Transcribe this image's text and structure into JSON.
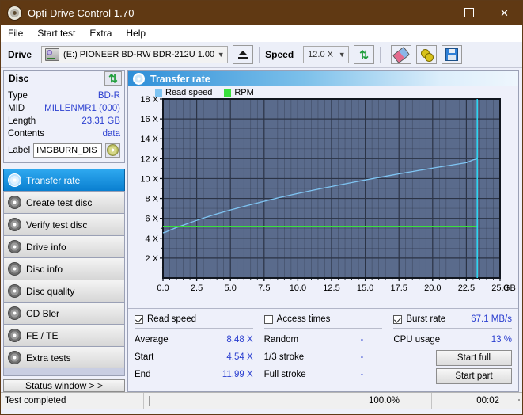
{
  "window": {
    "title": "Opti Drive Control 1.70",
    "icon": "disc-icon",
    "controls": {
      "minimize": "minimize-icon",
      "maximize": "maximize-icon",
      "close": "close-icon"
    }
  },
  "menu": {
    "items": [
      "File",
      "Start test",
      "Extra",
      "Help"
    ]
  },
  "toolbar": {
    "drive_label": "Drive",
    "drive_value": "(E:)  PIONEER BD-RW   BDR-212U 1.00",
    "eject_icon": "eject-icon",
    "speed_label": "Speed",
    "speed_value": "12.0 X",
    "refresh_icon": "refresh-icon",
    "erase_icon": "eraser-icon",
    "tools_icon": "bulb-icon",
    "save_icon": "floppy-save-icon"
  },
  "disc": {
    "header": "Disc",
    "refresh_icon": "refresh-icon",
    "rows": [
      {
        "key": "Type",
        "value": "BD-R"
      },
      {
        "key": "MID",
        "value": "MILLENMR1 (000)"
      },
      {
        "key": "Length",
        "value": "23.31 GB"
      },
      {
        "key": "Contents",
        "value": "data"
      }
    ],
    "label_key": "Label",
    "label_value": "IMGBURN_DIS",
    "disc_icon": "cd-icon"
  },
  "sidebar": {
    "items": [
      {
        "label": "Transfer rate",
        "icon": "disc-icon",
        "active": true
      },
      {
        "label": "Create test disc",
        "icon": "disc-icon",
        "active": false
      },
      {
        "label": "Verify test disc",
        "icon": "disc-icon",
        "active": false
      },
      {
        "label": "Drive info",
        "icon": "disc-icon",
        "active": false
      },
      {
        "label": "Disc info",
        "icon": "disc-icon",
        "active": false
      },
      {
        "label": "Disc quality",
        "icon": "disc-icon",
        "active": false
      },
      {
        "label": "CD Bler",
        "icon": "disc-icon",
        "active": false
      },
      {
        "label": "FE / TE",
        "icon": "disc-icon",
        "active": false
      },
      {
        "label": "Extra tests",
        "icon": "disc-icon",
        "active": false
      }
    ],
    "status_window_button": "Status window > >"
  },
  "panel": {
    "title": "Transfer rate",
    "icon": "disc-icon"
  },
  "chart_data": {
    "type": "line",
    "title": "Transfer rate",
    "xlabel": "GB",
    "ylabel": "X",
    "xlim": [
      0.0,
      25.0
    ],
    "ylim": [
      0,
      18
    ],
    "xticks": [
      "0.0",
      "2.5",
      "5.0",
      "7.5",
      "10.0",
      "12.5",
      "15.0",
      "17.5",
      "20.0",
      "22.5",
      "25.0"
    ],
    "xtick_values": [
      0.0,
      2.5,
      5.0,
      7.5,
      10.0,
      12.5,
      15.0,
      17.5,
      20.0,
      22.5,
      25.0
    ],
    "yticks": [
      "2 X",
      "4 X",
      "6 X",
      "8 X",
      "10 X",
      "12 X",
      "14 X",
      "16 X",
      "18 X"
    ],
    "ytick_values": [
      2,
      4,
      6,
      8,
      10,
      12,
      14,
      16,
      18
    ],
    "x_unit": "GB",
    "grid": true,
    "legend_position": "top-left",
    "plot_bg": "#5a6b8c",
    "grid_color": "#2b3345",
    "marker_x": 23.31,
    "marker_color": "#2fd4f0",
    "series": [
      {
        "name": "Read speed",
        "color": "#7fc4f2",
        "points": [
          [
            0.0,
            4.54
          ],
          [
            0.2,
            4.62
          ],
          [
            0.5,
            4.8
          ],
          [
            1.0,
            5.08
          ],
          [
            1.5,
            5.32
          ],
          [
            2.0,
            5.56
          ],
          [
            2.5,
            5.8
          ],
          [
            3.0,
            6.02
          ],
          [
            3.5,
            6.24
          ],
          [
            4.0,
            6.45
          ],
          [
            4.5,
            6.64
          ],
          [
            5.0,
            6.84
          ],
          [
            5.5,
            7.02
          ],
          [
            6.0,
            7.2
          ],
          [
            6.5,
            7.38
          ],
          [
            7.0,
            7.55
          ],
          [
            7.5,
            7.72
          ],
          [
            8.0,
            7.88
          ],
          [
            8.5,
            8.04
          ],
          [
            9.0,
            8.2
          ],
          [
            9.5,
            8.35
          ],
          [
            10.0,
            8.5
          ],
          [
            10.5,
            8.64
          ],
          [
            11.0,
            8.79
          ],
          [
            11.5,
            8.93
          ],
          [
            12.0,
            9.07
          ],
          [
            12.5,
            9.2
          ],
          [
            13.0,
            9.34
          ],
          [
            13.5,
            9.47
          ],
          [
            14.0,
            9.6
          ],
          [
            14.5,
            9.73
          ],
          [
            15.0,
            9.86
          ],
          [
            15.5,
            9.98
          ],
          [
            16.0,
            10.1
          ],
          [
            16.5,
            10.23
          ],
          [
            17.0,
            10.35
          ],
          [
            17.5,
            10.47
          ],
          [
            18.0,
            10.59
          ],
          [
            18.5,
            10.7
          ],
          [
            19.0,
            10.82
          ],
          [
            19.5,
            10.93
          ],
          [
            20.0,
            11.05
          ],
          [
            20.5,
            11.16
          ],
          [
            21.0,
            11.27
          ],
          [
            21.5,
            11.38
          ],
          [
            22.0,
            11.49
          ],
          [
            22.5,
            11.6
          ],
          [
            23.0,
            11.88
          ],
          [
            23.31,
            11.99
          ]
        ]
      },
      {
        "name": "RPM",
        "color": "#39e03c",
        "points": [
          [
            0.0,
            5.2
          ],
          [
            2.0,
            5.2
          ],
          [
            4.0,
            5.2
          ],
          [
            6.0,
            5.2
          ],
          [
            8.0,
            5.2
          ],
          [
            10.0,
            5.2
          ],
          [
            12.0,
            5.2
          ],
          [
            14.0,
            5.2
          ],
          [
            16.0,
            5.2
          ],
          [
            18.0,
            5.2
          ],
          [
            20.0,
            5.2
          ],
          [
            22.0,
            5.2
          ],
          [
            23.31,
            5.2
          ]
        ]
      }
    ],
    "legend": [
      {
        "label": "Read speed",
        "color": "#7fc4f2"
      },
      {
        "label": "RPM",
        "color": "#39e03c"
      }
    ]
  },
  "results": {
    "read_speed": {
      "checkbox_label": "Read speed",
      "checked": true,
      "rows": [
        {
          "key": "Average",
          "value": "8.48 X"
        },
        {
          "key": "Start",
          "value": "4.54 X"
        },
        {
          "key": "End",
          "value": "11.99 X"
        }
      ]
    },
    "access_times": {
      "checkbox_label": "Access times",
      "checked": false,
      "rows": [
        {
          "key": "Random",
          "value": "-"
        },
        {
          "key": "1/3 stroke",
          "value": "-"
        },
        {
          "key": "Full stroke",
          "value": "-"
        }
      ]
    },
    "burst_rate": {
      "checkbox_label": "Burst rate",
      "checked": true,
      "value": "67.1 MB/s",
      "cpu_key": "CPU usage",
      "cpu_value": "13 %"
    },
    "buttons": {
      "start_full": "Start full",
      "start_part": "Start part"
    }
  },
  "statusbar": {
    "text": "Test completed",
    "progress_percent": 100.0,
    "progress_label": "100.0%",
    "elapsed": "00:02",
    "progress_color": "#11a811"
  }
}
